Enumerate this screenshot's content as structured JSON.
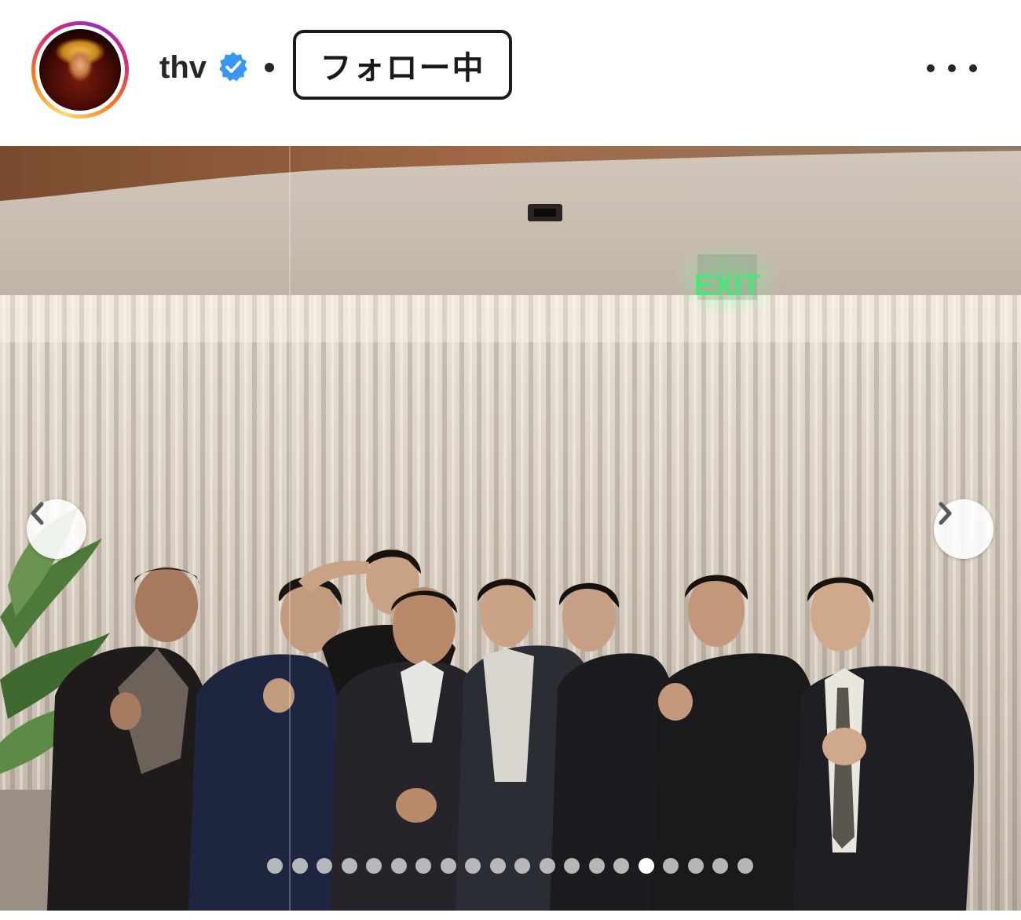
{
  "header": {
    "username": "thv",
    "verified": true,
    "separator": "•",
    "follow_label": "フォロー中",
    "more_icon": "more-horizontal-icon"
  },
  "photo": {
    "exit_sign_text": "EXIT",
    "slide_count": 20,
    "active_slide_index": 15
  },
  "colors": {
    "verified_blue": "#3897f0",
    "text": "#262626",
    "exit_green": "#4fe27a"
  }
}
